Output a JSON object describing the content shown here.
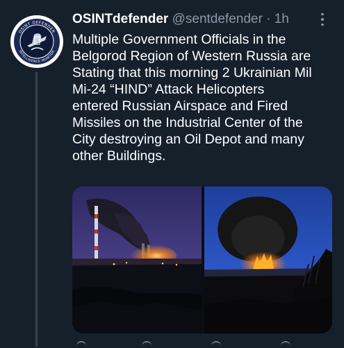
{
  "tweet": {
    "display_name": "OSINTdefender",
    "handle": "@sentdefender",
    "separator": "·",
    "time": "1h",
    "text": "Multiple Government Officials in the\nBelgorod Region of Western Russia are\nStating that this morning 2 Ukrainian Mil\nMi-24 “HIND” Attack Helicopters\nentered Russian Airspace and Fired\nMissiles on the Industrial Center of the\nCity destroying an Oil Depot and many\nother Buildings.",
    "avatar": {
      "ring_text_top": "OSINT DEFENDER",
      "ring_text_bottom": "INTELLIGENCE MONITOR"
    },
    "media": [
      {
        "description": "night photo of smoke plume over industrial chimneys with fire glow"
      },
      {
        "description": "night photo of large fire and dark smoke cloud at oil depot"
      }
    ]
  },
  "icons": {
    "more": "more-horizontal-icon"
  },
  "colors": {
    "background": "#15202b",
    "text_primary": "#ffffff",
    "text_secondary": "#8b98a5",
    "thread_line": "#38444d",
    "fire": "#ff8a1c"
  }
}
